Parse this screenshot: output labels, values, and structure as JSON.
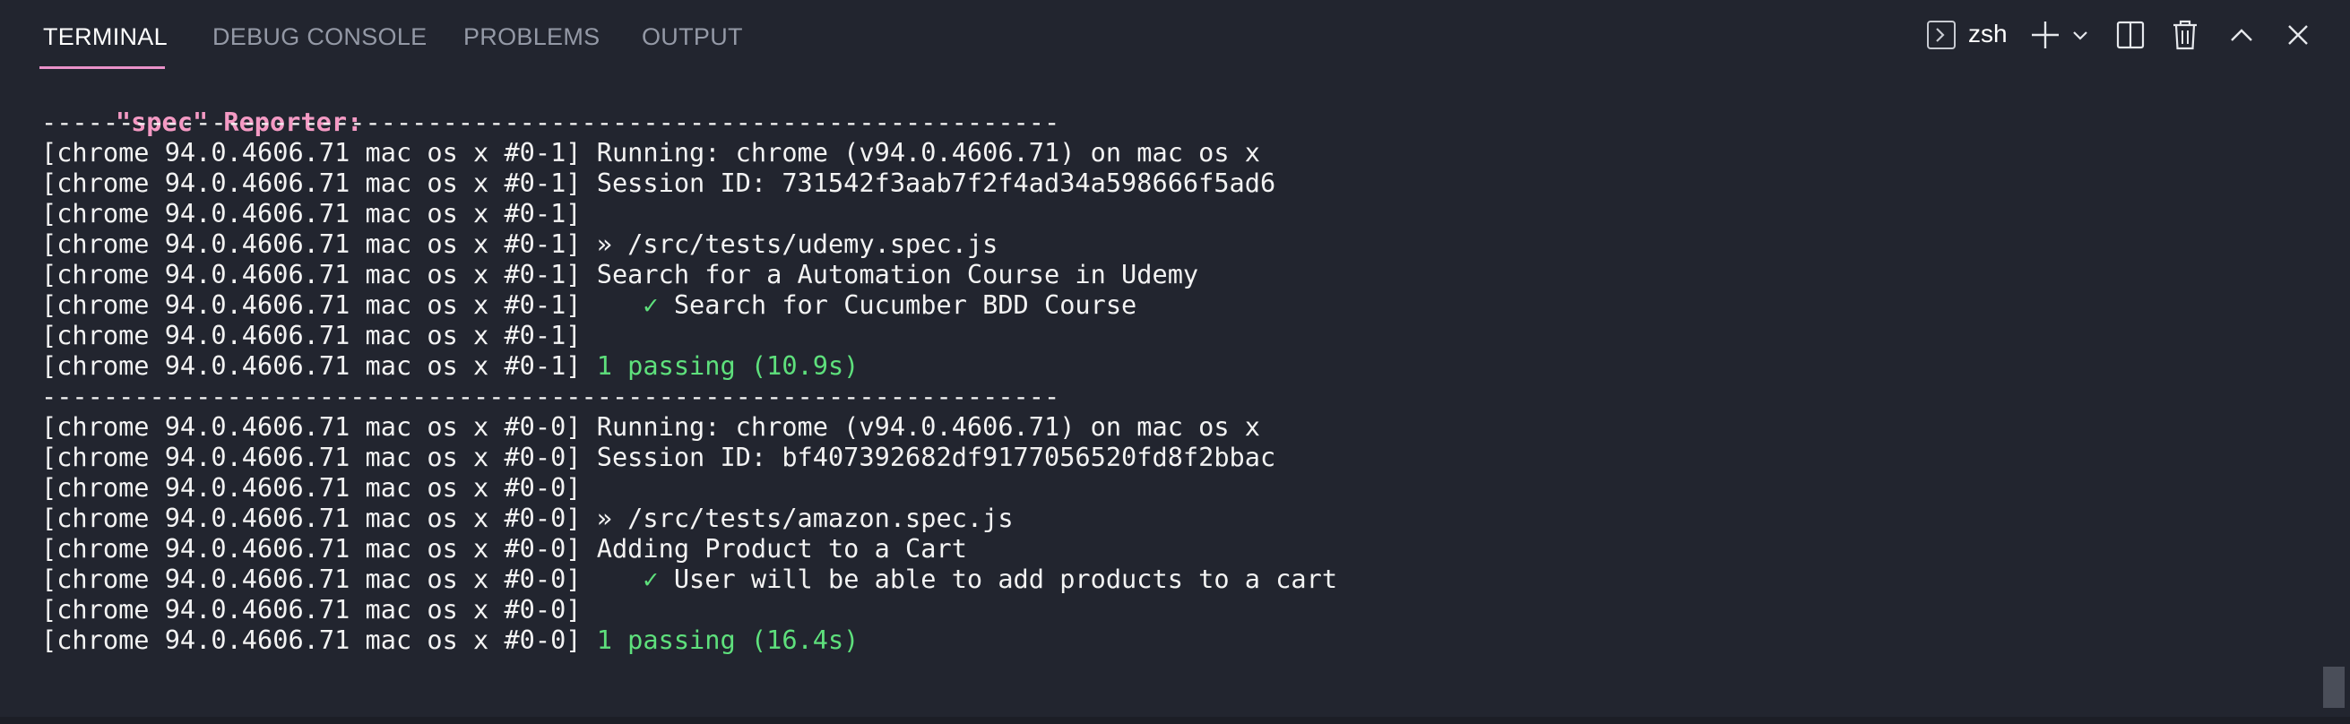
{
  "tabs": [
    {
      "label": "TERMINAL",
      "active": true
    },
    {
      "label": "DEBUG CONSOLE",
      "active": false
    },
    {
      "label": "PROBLEMS",
      "active": false
    },
    {
      "label": "OUTPUT",
      "active": false
    }
  ],
  "toolbar": {
    "shell_icon": "terminal-prompt-icon",
    "shell_name": "zsh",
    "actions": [
      "new-terminal-plus-icon",
      "chevron-down-icon",
      "split-terminal-icon",
      "trash-icon",
      "maximize-chevron-up-icon",
      "close-icon"
    ]
  },
  "colors": {
    "background": "#22252f",
    "active_tab_underline": "#e991c9",
    "reporter_heading": "#f49ac4",
    "passing_text": "#5ee07c",
    "text": "#f3f3f3",
    "inactive_tab": "#9499a6"
  },
  "terminal": {
    "reporter_heading": "\"spec\" Reporter:",
    "separator": "------------------------------------------------------------------",
    "lines": [
      {
        "prefix": "[chrome 94.0.4606.71 mac os x #0-1]",
        "text": " Running: chrome (v94.0.4606.71) on mac os x"
      },
      {
        "prefix": "[chrome 94.0.4606.71 mac os x #0-1]",
        "text": " Session ID: 731542f3aab7f2f4ad34a598666f5ad6"
      },
      {
        "prefix": "[chrome 94.0.4606.71 mac os x #0-1]",
        "text": ""
      },
      {
        "prefix": "[chrome 94.0.4606.71 mac os x #0-1]",
        "text": " » /src/tests/udemy.spec.js"
      },
      {
        "prefix": "[chrome 94.0.4606.71 mac os x #0-1]",
        "text": " Search for a Automation Course in Udemy"
      },
      {
        "prefix": "[chrome 94.0.4606.71 mac os x #0-1]",
        "check": "    ✓",
        "text": " Search for Cucumber BDD Course"
      },
      {
        "prefix": "[chrome 94.0.4606.71 mac os x #0-1]",
        "text": ""
      },
      {
        "prefix": "[chrome 94.0.4606.71 mac os x #0-1]",
        "passing": " 1 passing (10.9s)"
      },
      {
        "prefix": "[chrome 94.0.4606.71 mac os x #0-0]",
        "text": " Running: chrome (v94.0.4606.71) on mac os x"
      },
      {
        "prefix": "[chrome 94.0.4606.71 mac os x #0-0]",
        "text": " Session ID: bf407392682df9177056520fd8f2bbac"
      },
      {
        "prefix": "[chrome 94.0.4606.71 mac os x #0-0]",
        "text": ""
      },
      {
        "prefix": "[chrome 94.0.4606.71 mac os x #0-0]",
        "text": " » /src/tests/amazon.spec.js"
      },
      {
        "prefix": "[chrome 94.0.4606.71 mac os x #0-0]",
        "text": " Adding Product to a Cart"
      },
      {
        "prefix": "[chrome 94.0.4606.71 mac os x #0-0]",
        "check": "    ✓",
        "text": " User will be able to add products to a cart"
      },
      {
        "prefix": "[chrome 94.0.4606.71 mac os x #0-0]",
        "text": ""
      },
      {
        "prefix": "[chrome 94.0.4606.71 mac os x #0-0]",
        "passing": " 1 passing (16.4s)"
      }
    ]
  }
}
